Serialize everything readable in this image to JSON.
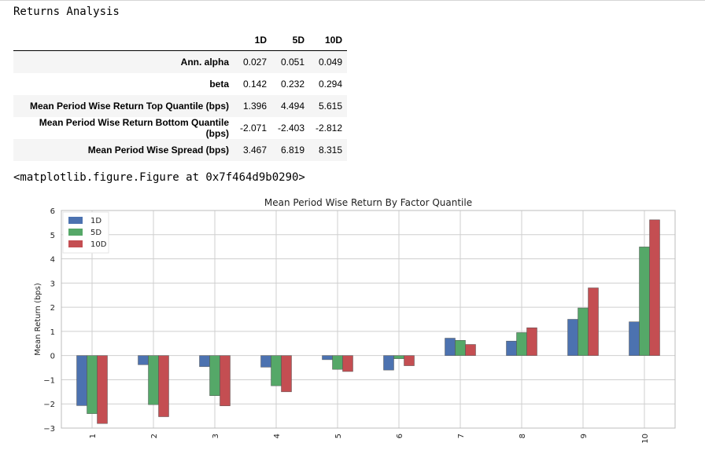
{
  "heading": "Returns Analysis",
  "table": {
    "columns": [
      "",
      "1D",
      "5D",
      "10D"
    ],
    "rows": [
      {
        "label": "Ann. alpha",
        "values": [
          "0.027",
          "0.051",
          "0.049"
        ]
      },
      {
        "label": "beta",
        "values": [
          "0.142",
          "0.232",
          "0.294"
        ]
      },
      {
        "label": "Mean Period Wise Return Top Quantile (bps)",
        "values": [
          "1.396",
          "4.494",
          "5.615"
        ]
      },
      {
        "label": "Mean Period Wise Return Bottom Quantile (bps)",
        "values": [
          "-2.071",
          "-2.403",
          "-2.812"
        ]
      },
      {
        "label": "Mean Period Wise Spread (bps)",
        "values": [
          "3.467",
          "6.819",
          "8.315"
        ]
      }
    ]
  },
  "figure_repr": "<matplotlib.figure.Figure at 0x7f464d9b0290>",
  "chart_data": {
    "type": "bar",
    "title": "Mean Period Wise Return By Factor Quantile",
    "xlabel": "",
    "ylabel": "Mean Return (bps)",
    "ylim": [
      -3,
      6
    ],
    "yticks": [
      "−3",
      "−2",
      "−1",
      "0",
      "1",
      "2",
      "3",
      "4",
      "5",
      "6"
    ],
    "categories": [
      "1",
      "2",
      "3",
      "4",
      "5",
      "6",
      "7",
      "8",
      "9",
      "10"
    ],
    "grid": true,
    "legend_position": "top-left",
    "series": [
      {
        "name": "1D",
        "color": "#4c72b0",
        "values": [
          -2.071,
          -0.38,
          -0.46,
          -0.48,
          -0.17,
          -0.6,
          0.72,
          0.6,
          1.5,
          1.396
        ]
      },
      {
        "name": "5D",
        "color": "#55a868",
        "values": [
          -2.403,
          -2.03,
          -1.66,
          -1.25,
          -0.57,
          -0.13,
          0.63,
          0.95,
          1.97,
          4.494
        ]
      },
      {
        "name": "10D",
        "color": "#c44e52",
        "values": [
          -2.812,
          -2.53,
          -2.08,
          -1.5,
          -0.66,
          -0.42,
          0.46,
          1.15,
          2.8,
          5.615
        ]
      }
    ]
  }
}
